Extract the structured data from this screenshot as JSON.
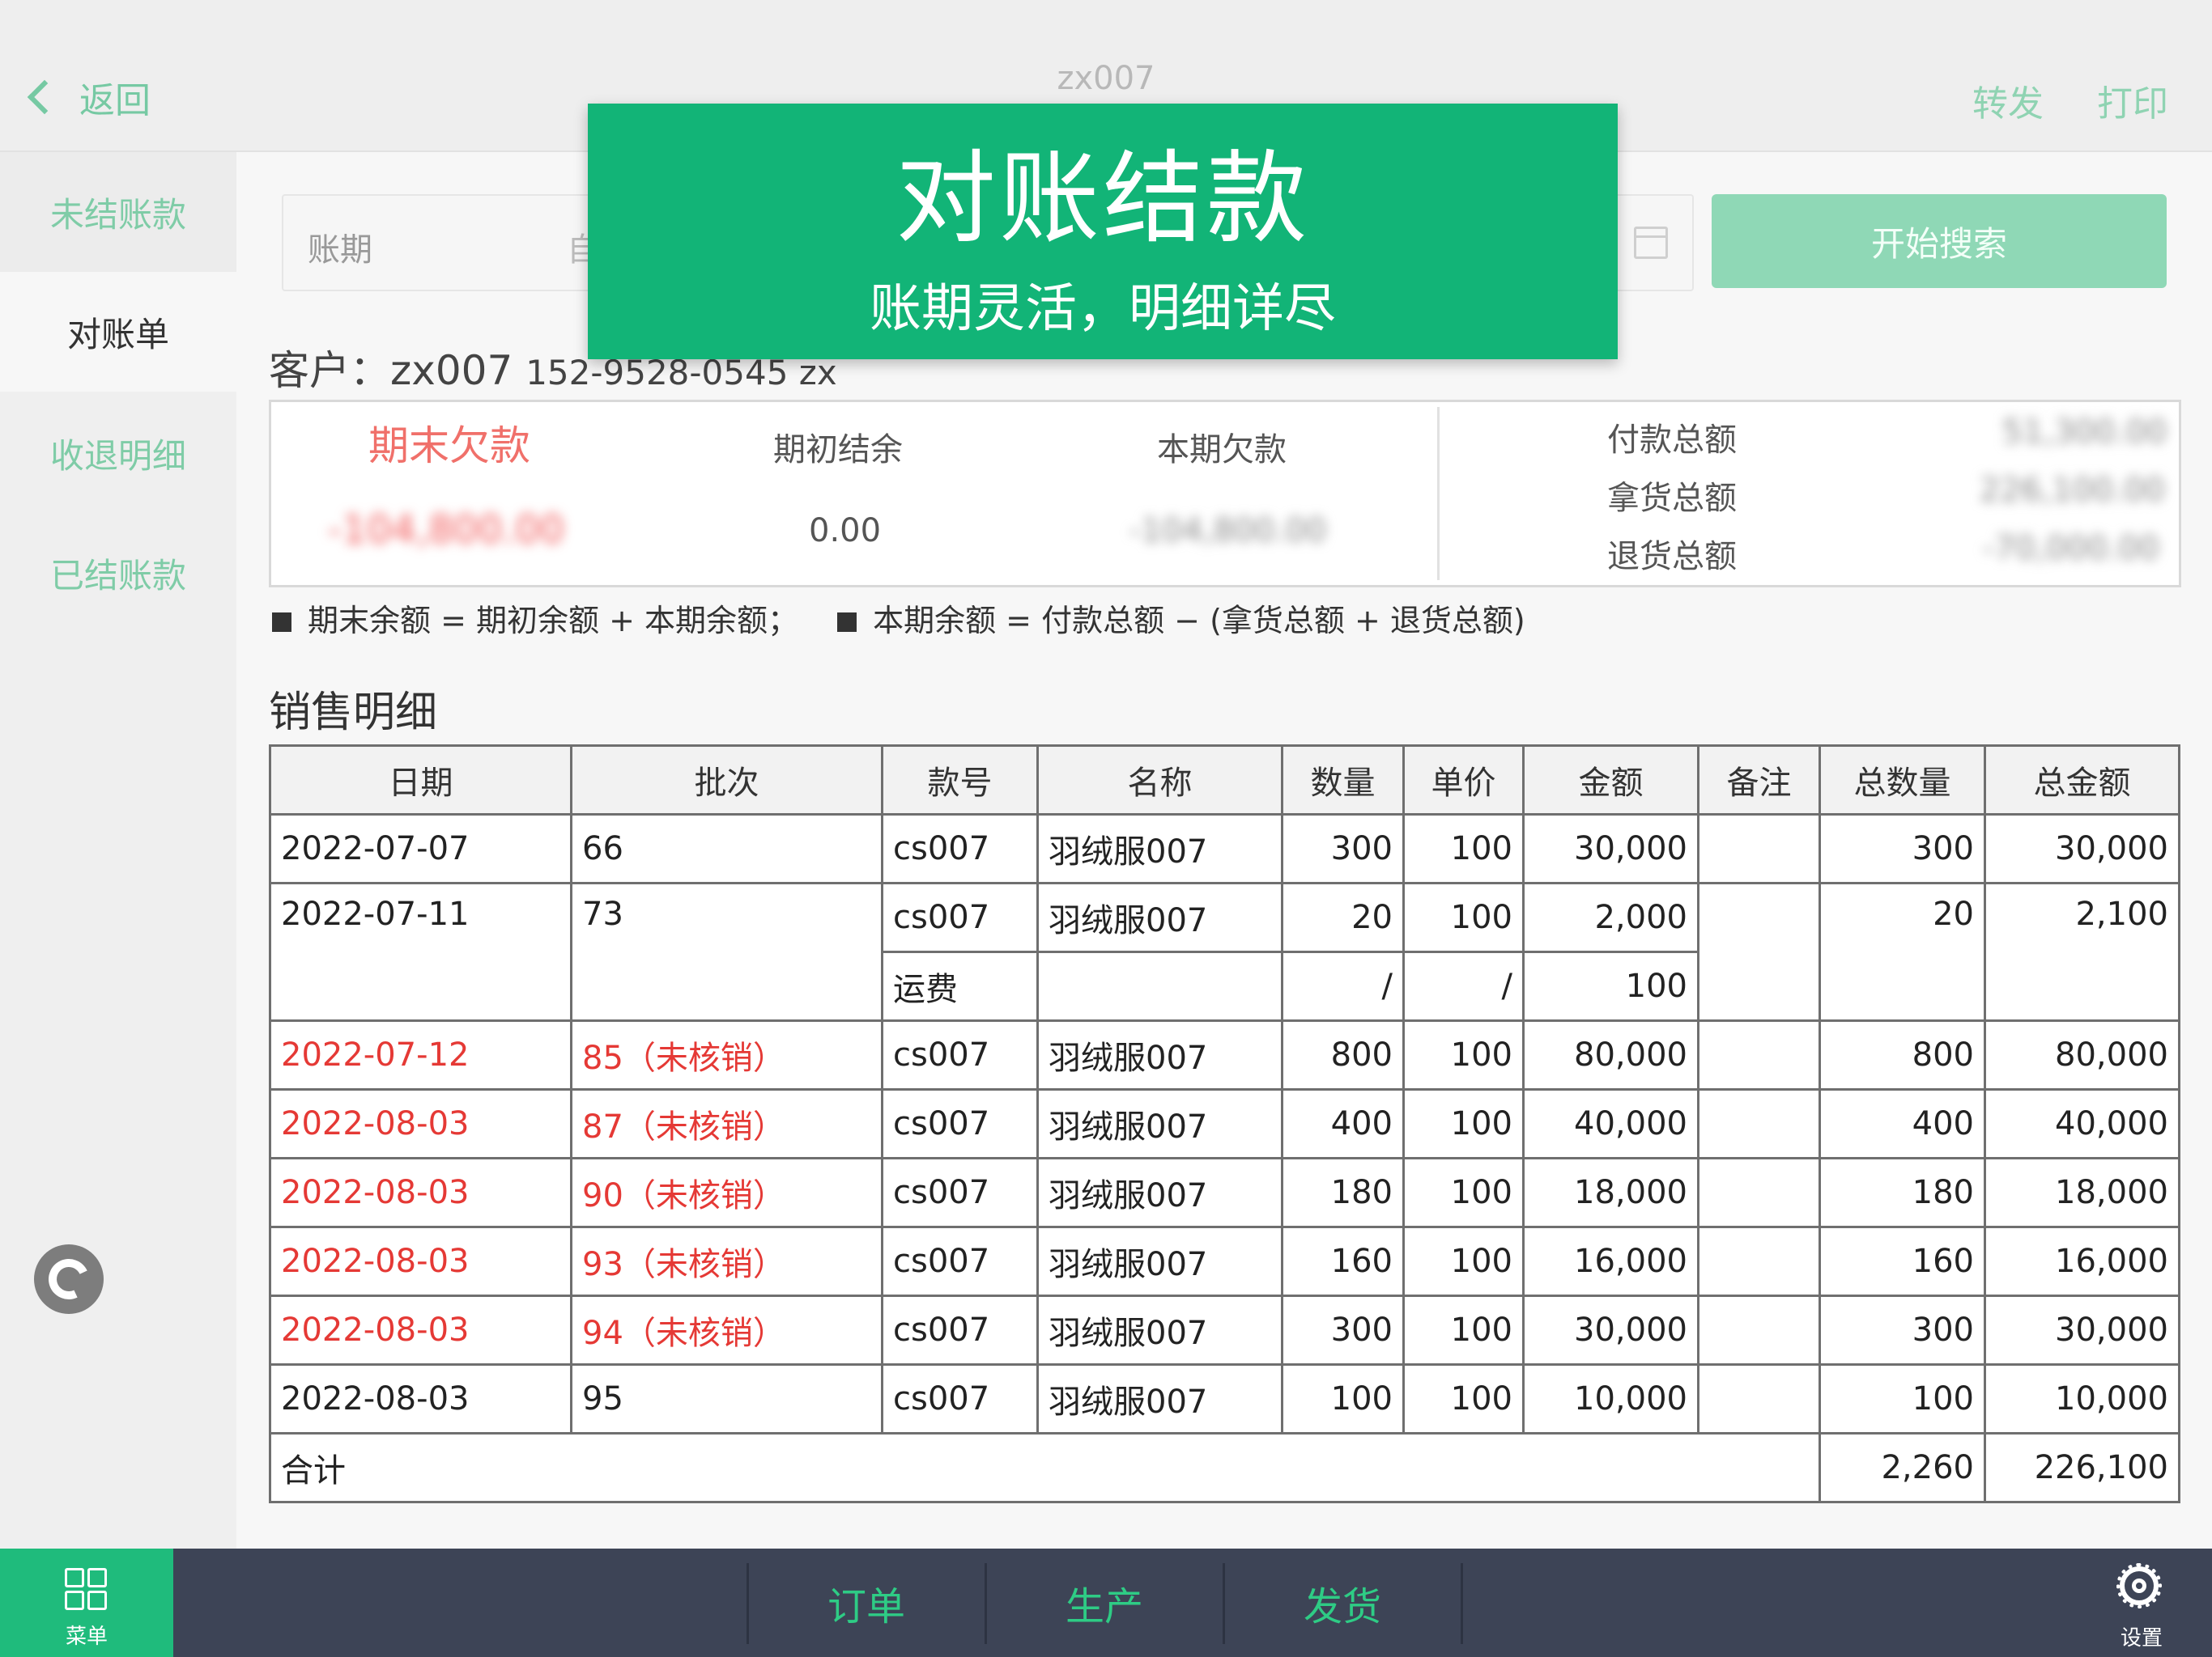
{
  "header": {
    "back_label": "返回",
    "title": "zx007",
    "forward_label": "转发",
    "print_label": "打印"
  },
  "sidebar": {
    "items": [
      {
        "label": "未结账款"
      },
      {
        "label": "对账单"
      },
      {
        "label": "收退明细"
      },
      {
        "label": "已结账款"
      }
    ]
  },
  "search": {
    "period_label": "账期",
    "mid_text": "自",
    "button_label": "开始搜索"
  },
  "customer": {
    "prefix": "客户：",
    "name": "zx007",
    "phone": "152-9528-0545 zx"
  },
  "summary": {
    "closing_debt_label": "期末欠款",
    "closing_debt_value": "-104,800.00",
    "opening_balance_label": "期初结余",
    "opening_balance_value": "0.00",
    "period_debt_label": "本期欠款",
    "period_debt_value": "-104,800.00",
    "payment_total_label": "付款总额",
    "payment_total_value": "51,300.00",
    "goods_total_label": "拿货总额",
    "goods_total_value": "226,100.00",
    "return_total_label": "退货总额",
    "return_total_value": "-70,000.00"
  },
  "formula": {
    "part1": "期末余额 = 期初余额 + 本期余额；",
    "part2": "本期余额 = 付款总额 − (拿货总额 + 退货总额)"
  },
  "sales": {
    "title": "销售明细",
    "columns": [
      "日期",
      "批次",
      "款号",
      "名称",
      "数量",
      "单价",
      "金额",
      "备注",
      "总数量",
      "总金额"
    ],
    "rows": [
      {
        "date": "2022-07-07",
        "batch": "66",
        "code": "cs007",
        "name": "羽绒服007",
        "qty": "300",
        "price": "100",
        "amount": "30,000",
        "note": "",
        "total_qty": "300",
        "total_amount": "30,000"
      },
      {
        "date": "2022-07-11",
        "batch": "73",
        "code": "cs007",
        "name": "羽绒服007",
        "qty": "20",
        "price": "100",
        "amount": "2,000",
        "note": "",
        "total_qty": "20",
        "total_amount": "2,100",
        "extra": {
          "code": "运费",
          "name": "",
          "qty": "/",
          "price": "/",
          "amount": "100"
        }
      },
      {
        "date": "2022-07-12",
        "batch": "85（未核销）",
        "code": "cs007",
        "name": "羽绒服007",
        "qty": "800",
        "price": "100",
        "amount": "80,000",
        "note": "",
        "total_qty": "800",
        "total_amount": "80,000"
      },
      {
        "date": "2022-08-03",
        "batch": "87（未核销）",
        "code": "cs007",
        "name": "羽绒服007",
        "qty": "400",
        "price": "100",
        "amount": "40,000",
        "note": "",
        "total_qty": "400",
        "total_amount": "40,000"
      },
      {
        "date": "2022-08-03",
        "batch": "90（未核销）",
        "code": "cs007",
        "name": "羽绒服007",
        "qty": "180",
        "price": "100",
        "amount": "18,000",
        "note": "",
        "total_qty": "180",
        "total_amount": "18,000"
      },
      {
        "date": "2022-08-03",
        "batch": "93（未核销）",
        "code": "cs007",
        "name": "羽绒服007",
        "qty": "160",
        "price": "100",
        "amount": "16,000",
        "note": "",
        "total_qty": "160",
        "total_amount": "16,000"
      },
      {
        "date": "2022-08-03",
        "batch": "94（未核销）",
        "code": "cs007",
        "name": "羽绒服007",
        "qty": "300",
        "price": "100",
        "amount": "30,000",
        "note": "",
        "total_qty": "300",
        "total_amount": "30,000"
      },
      {
        "date": "2022-08-03",
        "batch": "95",
        "code": "cs007",
        "name": "羽绒服007",
        "qty": "100",
        "price": "100",
        "amount": "10,000",
        "note": "",
        "total_qty": "100",
        "total_amount": "10,000"
      }
    ],
    "total": {
      "label": "合计",
      "total_qty": "2,260",
      "total_amount": "226,100"
    }
  },
  "bottom_nav": {
    "menu_label": "菜单",
    "orders_label": "订单",
    "production_label": "生产",
    "shipping_label": "发货",
    "settings_label": "设置"
  },
  "banner": {
    "title": "对账结款",
    "subtitle": "账期灵活，明细详尽"
  },
  "colors": {
    "accent": "#12b477",
    "bottom_bar": "#3d4456",
    "overdue_red": "#e53935"
  }
}
